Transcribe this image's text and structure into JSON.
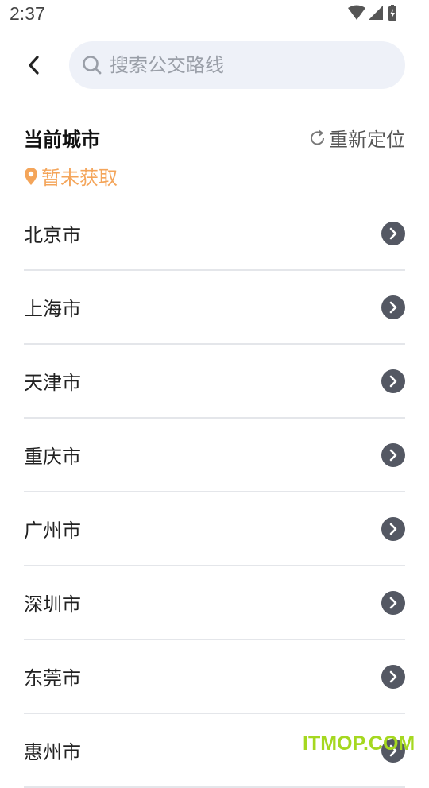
{
  "status_bar": {
    "time": "2:37",
    "icons": [
      "wifi-icon",
      "signal-icon",
      "battery-charging-icon"
    ]
  },
  "header": {
    "back_icon": "chevron-left-icon",
    "search": {
      "placeholder": "搜索公交路线",
      "value": "",
      "icon": "search-icon"
    }
  },
  "current_city": {
    "title": "当前城市",
    "relocate_label": "重新定位",
    "relocate_icon": "refresh-icon",
    "status_icon": "location-pin-icon",
    "status_text": "暂未获取"
  },
  "cities": [
    {
      "name": "北京市"
    },
    {
      "name": "上海市"
    },
    {
      "name": "天津市"
    },
    {
      "name": "重庆市"
    },
    {
      "name": "广州市"
    },
    {
      "name": "深圳市"
    },
    {
      "name": "东莞市"
    },
    {
      "name": "惠州市"
    }
  ],
  "watermark": "ITMOP.COM",
  "colors": {
    "accent_orange": "#f4a55a",
    "search_bg": "#eef1f8",
    "arrow_bg": "#545863",
    "divider": "#e4e6ea",
    "watermark": "#a5d820"
  }
}
